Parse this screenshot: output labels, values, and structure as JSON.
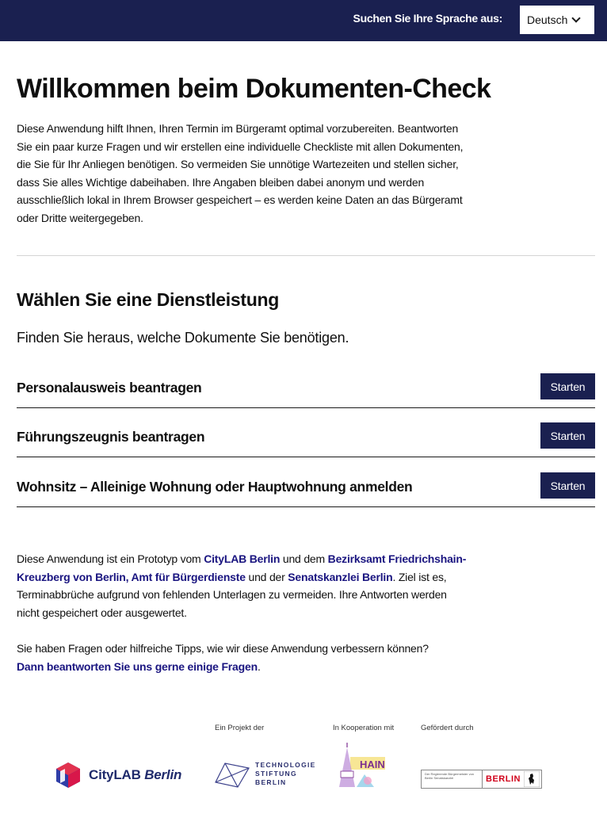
{
  "header": {
    "language_label": "Suchen Sie Ihre Sprache aus:",
    "language_selected": "Deutsch"
  },
  "main": {
    "title": "Willkommen beim Dokumenten-Check",
    "intro": "Diese Anwendung hilft Ihnen, Ihren Termin im Bürgeramt optimal vorzubereiten. Beantworten Sie ein paar kurze Fragen und wir erstellen eine individuelle Checkliste mit allen Dokumenten, die Sie für Ihr Anliegen benötigen. So vermeiden Sie unnötige Wartezeiten und stellen sicher, dass Sie alles Wichtige dabeihaben. Ihre Angaben bleiben dabei anonym und werden ausschließlich lokal in Ihrem Browser gespeichert – es werden keine Daten an das Bürgeramt oder Dritte weitergegeben."
  },
  "services": {
    "heading": "Wählen Sie eine Dienstleistung",
    "subtitle": "Finden Sie heraus, welche Dokumente Sie benötigen.",
    "items": [
      {
        "label": "Personalausweis beantragen",
        "button": "Starten"
      },
      {
        "label": "Führungszeugnis beantragen",
        "button": "Starten"
      },
      {
        "label": "Wohnsitz – Alleinige Wohnung oder Hauptwohnung anmelden",
        "button": "Starten"
      }
    ]
  },
  "about": {
    "text_1": "Diese Anwendung ist ein Prototyp vom ",
    "link_citylab": "CityLAB Berlin",
    "text_2": " und dem ",
    "link_bezirksamt": "Bezirksamt Friedrichshain-Kreuzberg von Berlin, Amt für Bürgerdienste",
    "text_3": " und der ",
    "link_senatskanzlei": "Senatskanzlei Berlin",
    "text_4": ". Ziel ist es, Terminabbrüche aufgrund von fehlenden Unterlagen zu vermeiden. Ihre Antworten werden nicht gespeichert oder ausgewertet."
  },
  "feedback": {
    "text": "Sie haben Fragen oder hilfreiche Tipps, wie wir diese Anwendung verbessern können?",
    "link": "Dann beantworten Sie uns gerne einige Fragen",
    "suffix": "."
  },
  "footer": {
    "caption_project": "Ein Projekt der",
    "caption_cooperation": "In Kooperation mit",
    "caption_funded": "Gefördert durch",
    "logo_citylab_a": "CityLAB",
    "logo_citylab_b": "Berlin",
    "logo_tsb_1": "TECHNOLOGIE",
    "logo_tsb_2": "STIFTUNG",
    "logo_tsb_3": "BERLIN",
    "logo_berlin_small": "Der Regierende Bürgermeister von Berlin Senatskanzlei",
    "logo_berlin_big": "BERLIN"
  },
  "colors": {
    "navy": "#1a2050",
    "link": "#1a1580"
  }
}
